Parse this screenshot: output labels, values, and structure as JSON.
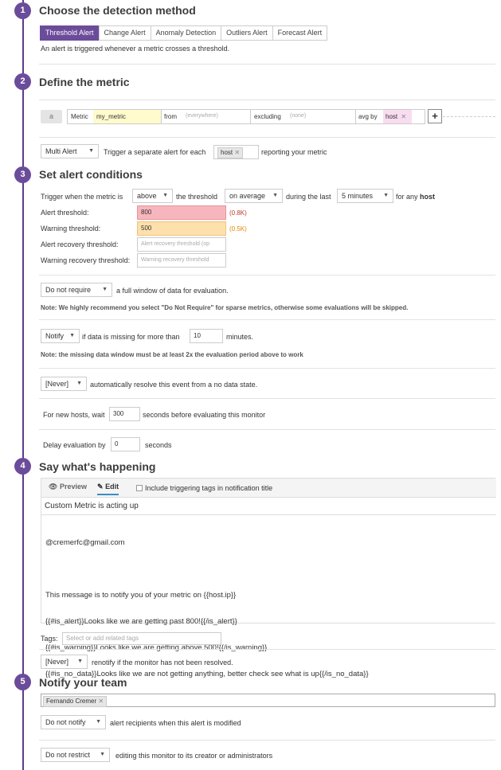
{
  "steps": {
    "s1": {
      "number": "1",
      "title": "Choose the detection method"
    },
    "s2": {
      "number": "2",
      "title": "Define the metric"
    },
    "s3": {
      "number": "3",
      "title": "Set alert conditions"
    },
    "s4": {
      "number": "4",
      "title": "Say what's happening"
    },
    "s5": {
      "number": "5",
      "title": "Notify your team"
    }
  },
  "detection": {
    "tabs": [
      "Threshold Alert",
      "Change Alert",
      "Anomaly Detection",
      "Outliers Alert",
      "Forecast Alert"
    ],
    "active_tab": "Threshold Alert",
    "description": "An alert is triggered whenever a metric crosses a threshold."
  },
  "metric": {
    "query_letter": "a",
    "metric_label": "Metric",
    "metric_value": "my_metric",
    "from_label": "from",
    "from_value": "(everywhere)",
    "excluding_label": "excluding",
    "excluding_value": "(none)",
    "avg_by_label": "avg by",
    "avg_by_value": "host",
    "add_button": "+",
    "alert_type": "Multi Alert",
    "alert_type_text": "Trigger a separate alert for each",
    "group_tag": "host",
    "group_suffix": "reporting your metric"
  },
  "conditions": {
    "trigger_prefix": "Trigger when the metric is",
    "comparator": "above",
    "threshold_text": "the threshold",
    "aggregation": "on average",
    "during_text": "during the last",
    "window": "5 minutes",
    "for_any_text": "for any",
    "for_any_group": "host",
    "alert_threshold_label": "Alert threshold:",
    "alert_threshold_value": "800",
    "alert_threshold_hint": "(0.8K)",
    "warning_threshold_label": "Warning threshold:",
    "warning_threshold_value": "500",
    "warning_threshold_hint": "(0.5K)",
    "alert_recovery_label": "Alert recovery threshold:",
    "alert_recovery_placeholder": "Alert recovery threshold (op",
    "warning_recovery_label": "Warning recovery threshold:",
    "warning_recovery_placeholder": "Warning recovery threshold",
    "require_window": "Do not require",
    "require_window_text": "a full window of data for evaluation.",
    "require_note": "Note: We highly recommend you select \"Do Not Require\" for sparse metrics, otherwise some evaluations will be skipped.",
    "notify_missing": "Notify",
    "missing_text": "if data is missing for more than",
    "missing_minutes": "10",
    "minutes_text": "minutes.",
    "missing_note": "Note: the missing data window must be at least 2x the evaluation period above to work",
    "resolve": "[Never]",
    "resolve_text": "automatically resolve this event from a no data state.",
    "new_host_prefix": "For new hosts, wait",
    "new_host_value": "300",
    "new_host_suffix": "seconds before evaluating this monitor",
    "delay_prefix": "Delay evaluation by",
    "delay_value": "0",
    "delay_suffix": "seconds"
  },
  "message": {
    "preview_tab": "Preview",
    "edit_tab": "Edit",
    "include_tags_label": "Include triggering tags in notification title",
    "title_value": "Custom Metric is acting up",
    "body_lines": [
      "@cremerfc@gmail.com",
      "",
      "This message is to notify you of your metric on {{host.ip}}",
      "{{#is_alert}}Looks like we are getting past 800!{{/is_alert}}",
      "{{#is_warning}}Looks like we are getting above 500!{{/is_warning}}",
      "{{#is_no_data}}Looks like we are not getting anything, better check see what is up{{/is_no_data}}"
    ],
    "tags_label": "Tags:",
    "tags_placeholder": "Select or add related tags",
    "renotify": "[Never]",
    "renotify_text": "renotify if the monitor has not been resolved."
  },
  "notify": {
    "recipient": "Fernando Cremer",
    "modified_select": "Do not notify",
    "modified_text": "alert recipients when this alert is modified",
    "restrict_select": "Do not restrict",
    "restrict_text": "editing this monitor to its creator or administrators"
  },
  "colors": {
    "accent": "#6b4c9a",
    "alert_fill": "#f7b6bd",
    "warning_fill": "#fde0ac",
    "alert_hint": "#c0392b",
    "warning_hint": "#e08a00",
    "metric_fill": "#fffbcc",
    "group_fill": "#f9dcf0"
  }
}
